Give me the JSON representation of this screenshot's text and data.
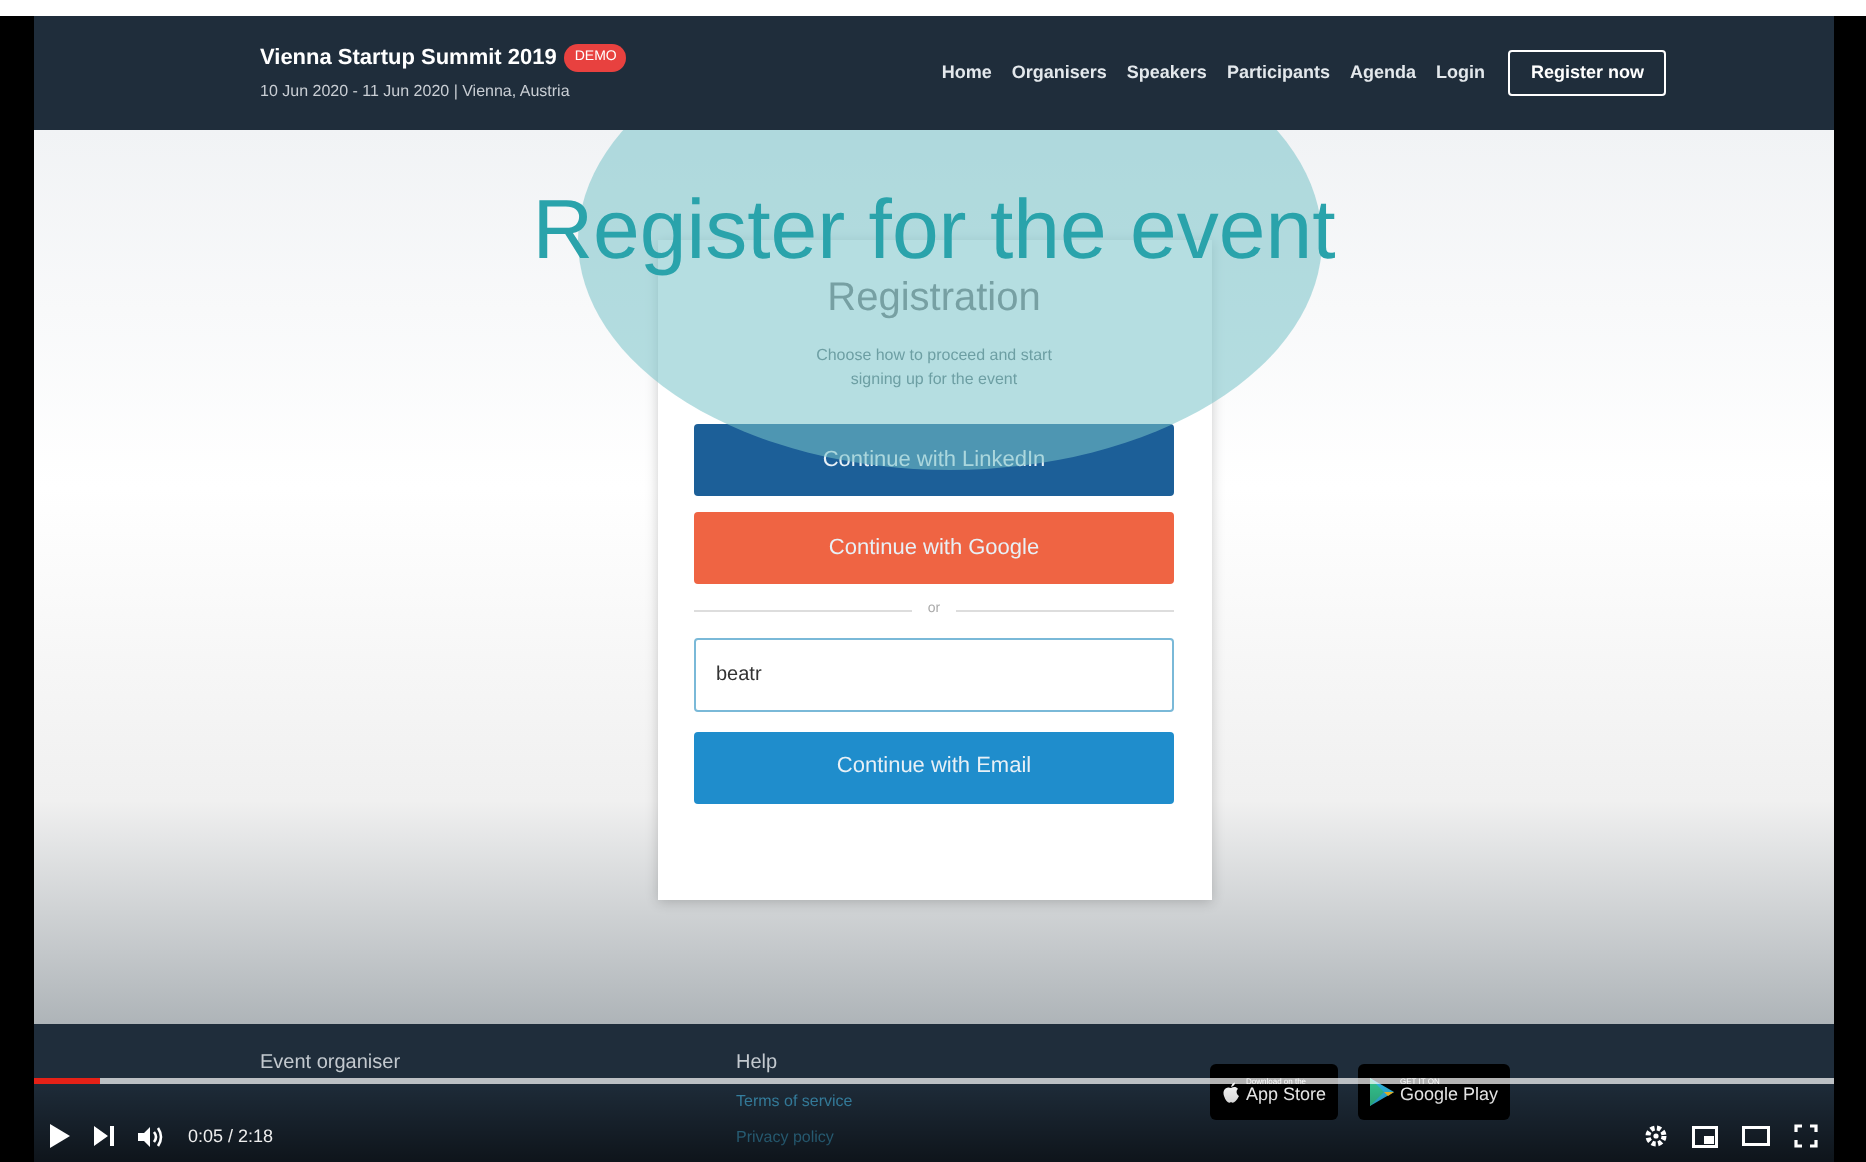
{
  "video_frame": {
    "header": {
      "title": "Vienna Startup Summit 2019",
      "badge": "DEMO",
      "subtitle": "10 Jun 2020 - 11 Jun 2020 | Vienna, Austria",
      "nav": [
        "Home",
        "Organisers",
        "Speakers",
        "Participants",
        "Agenda",
        "Login"
      ],
      "register_button": "Register now"
    },
    "caption": "Register for the event",
    "card": {
      "title": "Registration",
      "description": "Choose how to proceed and start signing up for the event",
      "social_buttons": [
        {
          "label": "Continue with LinkedIn",
          "kind": "linkedin"
        },
        {
          "label": "Continue with Google",
          "kind": "google"
        }
      ],
      "divider": "or",
      "email_field": {
        "value": "beatr"
      },
      "email_button": "Continue with Email"
    },
    "footer": {
      "columns": [
        {
          "heading": "Event organiser"
        },
        {
          "heading": "Help",
          "links": [
            "Terms of service",
            "Privacy policy"
          ]
        }
      ],
      "store_badges": [
        {
          "kind": "apple",
          "small": "Download on the",
          "big": "App Store"
        },
        {
          "kind": "google",
          "small": "GET IT ON",
          "big": "Google Play"
        }
      ]
    }
  },
  "player": {
    "progress": {
      "level": 0.037
    },
    "time": "0:05 / 2:18"
  }
}
